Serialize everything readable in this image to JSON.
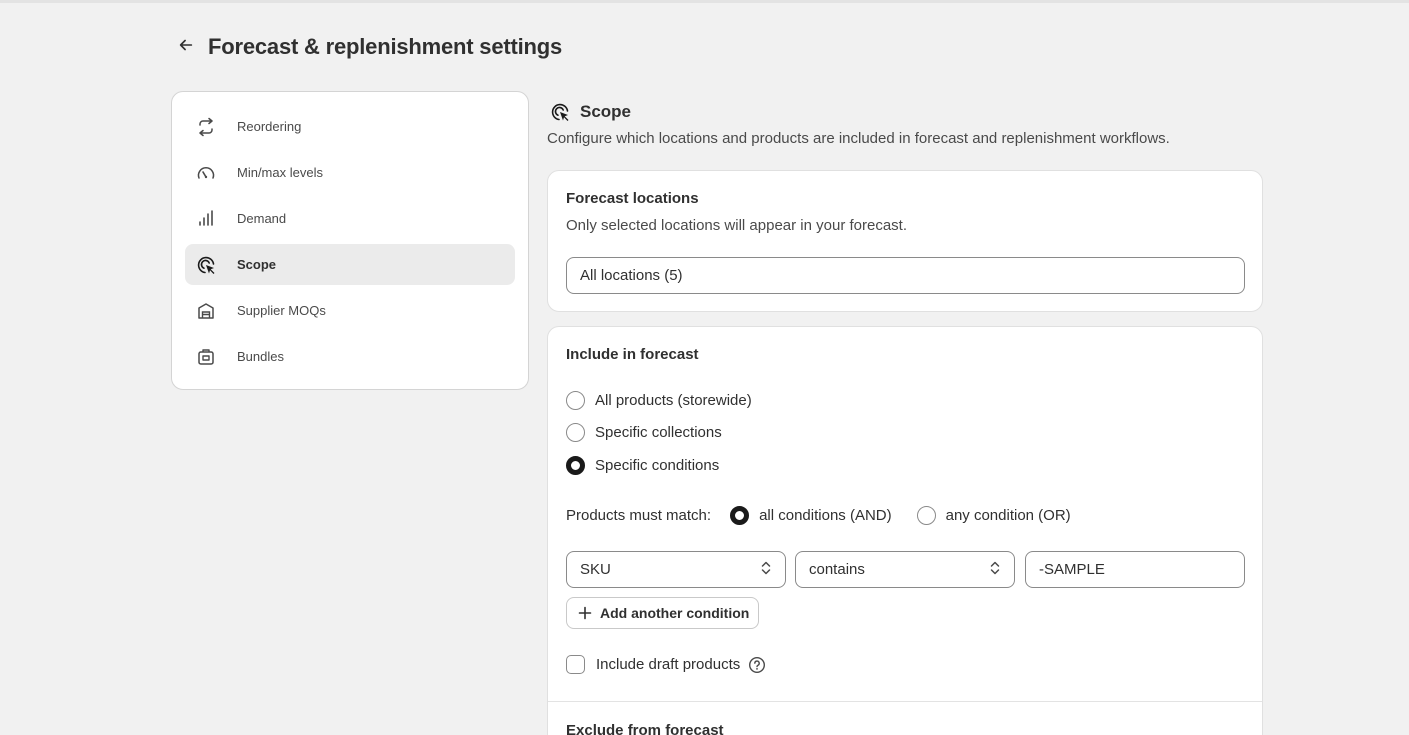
{
  "page": {
    "title": "Forecast & replenishment settings",
    "back_icon": "arrow-left-icon"
  },
  "sidebar": {
    "items": [
      {
        "label": "Reordering",
        "icon": "refresh-icon",
        "active": false
      },
      {
        "label": "Min/max levels",
        "icon": "gauge-icon",
        "active": false
      },
      {
        "label": "Demand",
        "icon": "bar-chart-icon",
        "active": false
      },
      {
        "label": "Scope",
        "icon": "target-pointer-icon",
        "active": true
      },
      {
        "label": "Supplier MOQs",
        "icon": "warehouse-icon",
        "active": false
      },
      {
        "label": "Bundles",
        "icon": "package-icon",
        "active": false
      }
    ]
  },
  "section": {
    "title": "Scope",
    "icon": "target-pointer-icon",
    "description": "Configure which locations and products are included in forecast and replenishment workflows."
  },
  "forecast_locations": {
    "title": "Forecast locations",
    "subtitle": "Only selected locations will appear in your forecast.",
    "selected_value": "All locations (5)"
  },
  "include": {
    "title": "Include in forecast",
    "options": [
      {
        "label": "All products (storewide)",
        "checked": false
      },
      {
        "label": "Specific collections",
        "checked": false
      },
      {
        "label": "Specific conditions",
        "checked": true
      }
    ],
    "match_label": "Products must match:",
    "match_options": [
      {
        "label": "all conditions (AND)",
        "checked": true
      },
      {
        "label": "any condition (OR)",
        "checked": false
      }
    ],
    "condition": {
      "field": "SKU",
      "operator": "contains",
      "value": "-SAMPLE"
    },
    "add_condition_label": "Add another condition",
    "draft_label": "Include draft products",
    "draft_checked": false
  },
  "exclude": {
    "title": "Exclude from forecast"
  },
  "colors": {
    "background": "#f1f1f1",
    "card": "#ffffff",
    "active_nav": "#ebebeb",
    "text": "#303030"
  }
}
